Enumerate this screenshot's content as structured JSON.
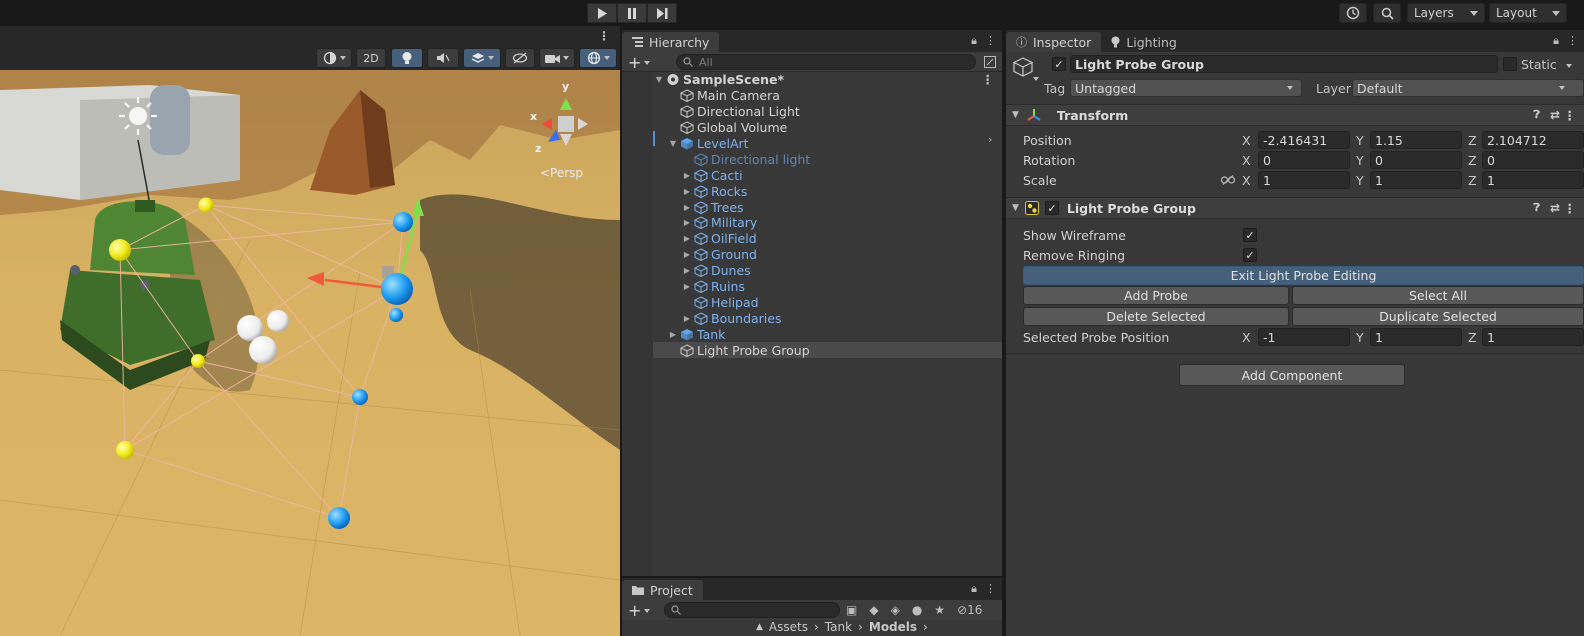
{
  "toolbar": {
    "play_icon": "play-icon",
    "pause_icon": "pause-icon",
    "step_icon": "step-icon",
    "history_icon": "history-icon",
    "search_icon": "search-icon",
    "layers_label": "Layers",
    "layout_label": "Layout"
  },
  "scene": {
    "mode_2d": "2D",
    "persp_label": "<Persp",
    "gizmo_axes": {
      "x": "x",
      "y": "y",
      "z": "z"
    }
  },
  "hierarchy": {
    "tab_label": "Hierarchy",
    "search_placeholder": "All",
    "add_label": "+",
    "items": [
      {
        "label": "SampleScene*",
        "depth": 0,
        "arrow": "down",
        "icon": "unity-scene-icon",
        "style": "bold"
      },
      {
        "label": "Main Camera",
        "depth": 1,
        "arrow": "",
        "icon": "gameobject-icon",
        "style": ""
      },
      {
        "label": "Directional Light",
        "depth": 1,
        "arrow": "",
        "icon": "gameobject-icon",
        "style": ""
      },
      {
        "label": "Global Volume",
        "depth": 1,
        "arrow": "",
        "icon": "gameobject-icon",
        "style": ""
      },
      {
        "label": "LevelArt",
        "depth": 1,
        "arrow": "down",
        "icon": "prefab-icon",
        "style": "blue"
      },
      {
        "label": "Directional light",
        "depth": 2,
        "arrow": "",
        "icon": "gameobject-icon",
        "style": "dim"
      },
      {
        "label": "Cacti",
        "depth": 2,
        "arrow": "right",
        "icon": "gameobject-icon",
        "style": "blue"
      },
      {
        "label": "Rocks",
        "depth": 2,
        "arrow": "right",
        "icon": "gameobject-icon",
        "style": "blue"
      },
      {
        "label": "Trees",
        "depth": 2,
        "arrow": "right",
        "icon": "gameobject-icon",
        "style": "blue"
      },
      {
        "label": "Military",
        "depth": 2,
        "arrow": "right",
        "icon": "gameobject-icon",
        "style": "blue"
      },
      {
        "label": "OilField",
        "depth": 2,
        "arrow": "right",
        "icon": "gameobject-icon",
        "style": "blue"
      },
      {
        "label": "Ground",
        "depth": 2,
        "arrow": "right",
        "icon": "gameobject-icon",
        "style": "blue"
      },
      {
        "label": "Dunes",
        "depth": 2,
        "arrow": "right",
        "icon": "gameobject-icon",
        "style": "blue"
      },
      {
        "label": "Ruins",
        "depth": 2,
        "arrow": "right",
        "icon": "gameobject-icon",
        "style": "blue"
      },
      {
        "label": "Helipad",
        "depth": 2,
        "arrow": "",
        "icon": "gameobject-icon",
        "style": "blue"
      },
      {
        "label": "Boundaries",
        "depth": 2,
        "arrow": "right",
        "icon": "gameobject-icon",
        "style": "blue"
      },
      {
        "label": "Tank",
        "depth": 1,
        "arrow": "right",
        "icon": "prefab-icon",
        "style": "blue"
      },
      {
        "label": "Light Probe Group",
        "depth": 1,
        "arrow": "",
        "icon": "gameobject-icon",
        "style": "selected"
      }
    ]
  },
  "project": {
    "tab_label": "Project",
    "hidden_count": "16",
    "breadcrumb": [
      "Assets",
      "Tank",
      "Models"
    ]
  },
  "inspector": {
    "tab_label": "Inspector",
    "lighting_tab_label": "Lighting",
    "object_name": "Light Probe Group",
    "static_label": "Static",
    "tag_label": "Tag",
    "tag_value": "Untagged",
    "layer_label": "Layer",
    "layer_value": "Default",
    "transform": {
      "title": "Transform",
      "rows": [
        {
          "label": "Position",
          "x": "-2.416431",
          "y": "1.15",
          "z": "2.104712"
        },
        {
          "label": "Rotation",
          "x": "0",
          "y": "0",
          "z": "0"
        },
        {
          "label": "Scale",
          "x": "1",
          "y": "1",
          "z": "1"
        }
      ],
      "axis_x": "X",
      "axis_y": "Y",
      "axis_z": "Z"
    },
    "probe_group": {
      "title": "Light Probe Group",
      "show_wireframe_label": "Show Wireframe",
      "show_wireframe": true,
      "remove_ringing_label": "Remove Ringing",
      "remove_ringing": true,
      "exit_editing_label": "Exit Light Probe Editing",
      "add_probe_label": "Add Probe",
      "select_all_label": "Select All",
      "delete_selected_label": "Delete Selected",
      "duplicate_selected_label": "Duplicate Selected",
      "selected_position_label": "Selected Probe Position",
      "sel_x": "-1",
      "sel_y": "1",
      "sel_z": "1"
    },
    "add_component_label": "Add Component"
  }
}
